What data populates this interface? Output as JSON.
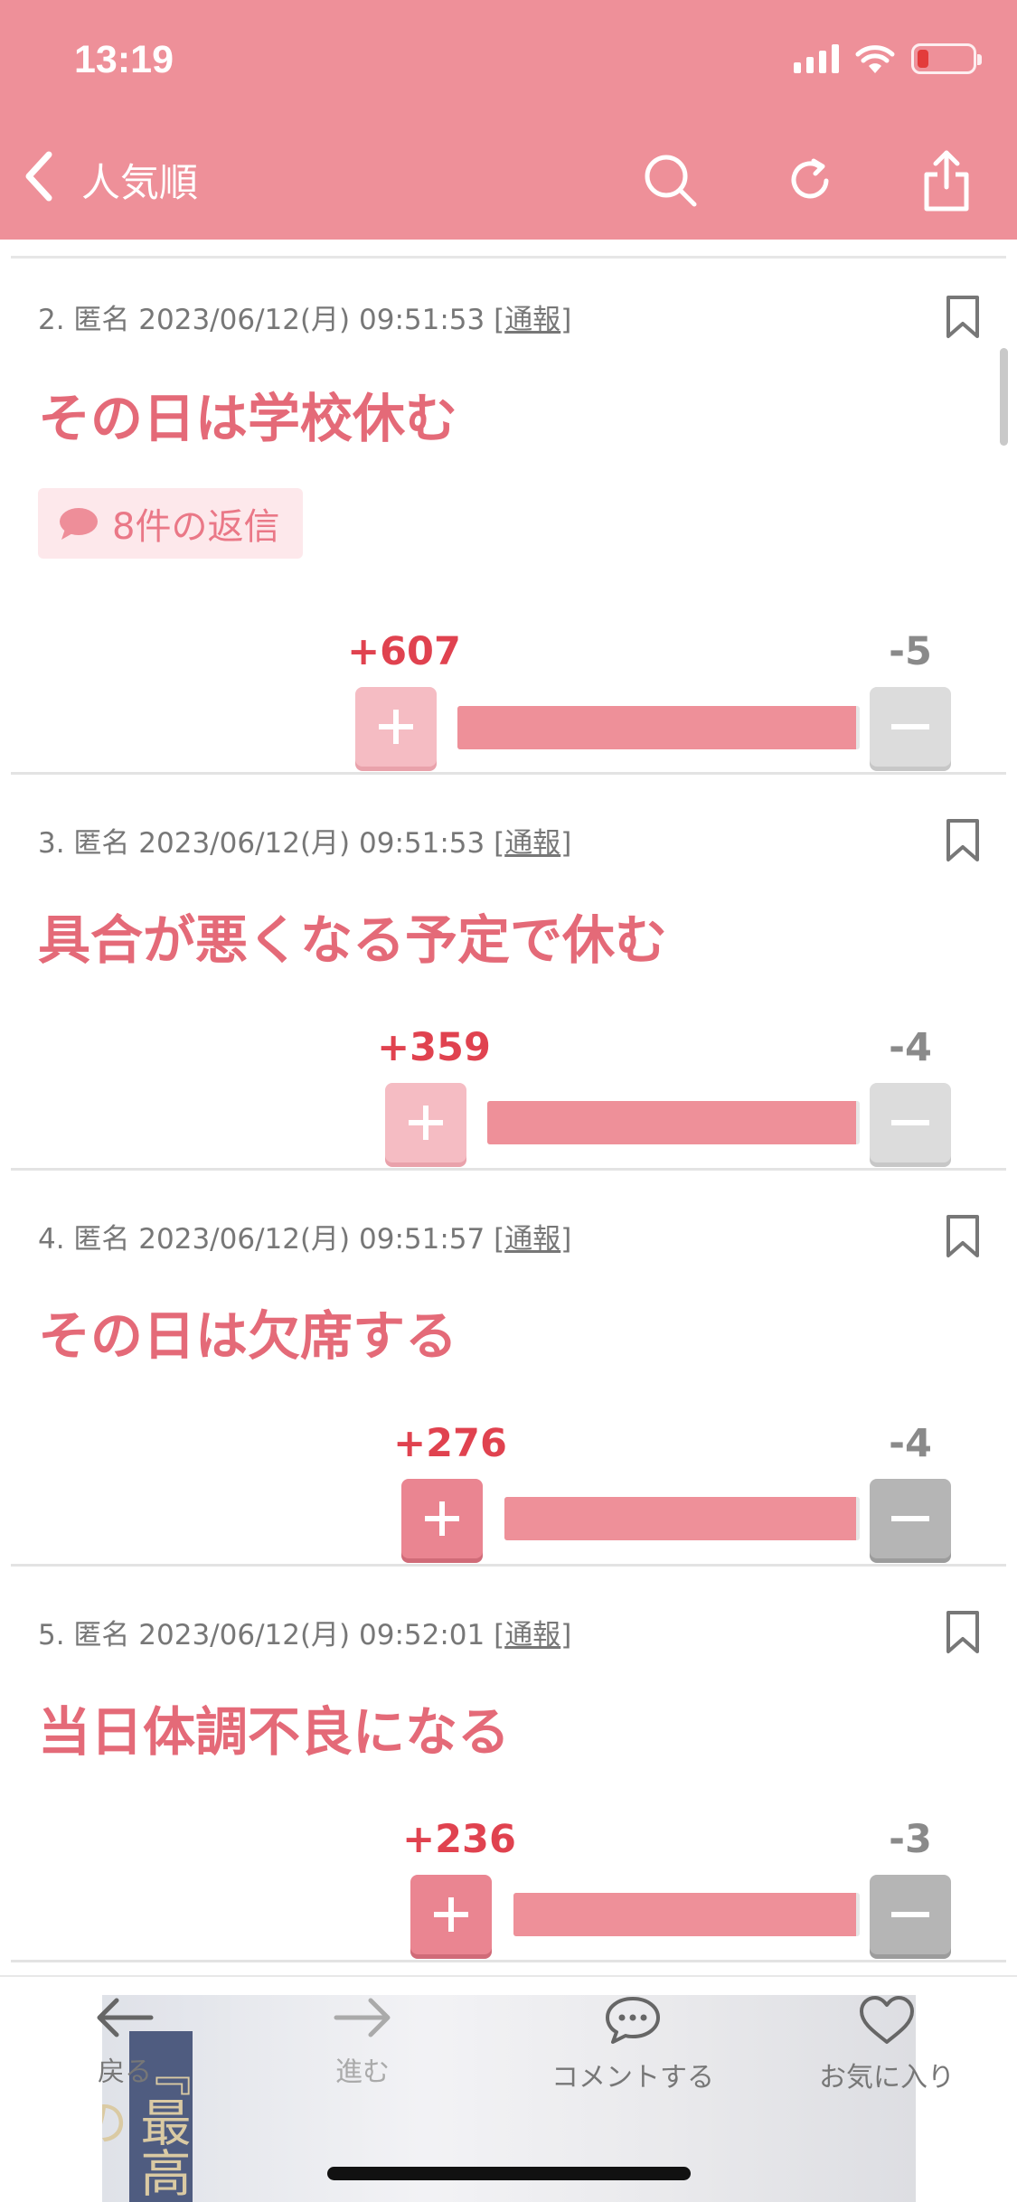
{
  "status_bar": {
    "time": "13:19"
  },
  "nav": {
    "title": "人気順"
  },
  "comments": [
    {
      "meta": "2. 匿名 2023/06/12(月) 09:51:53 [",
      "report": "通報",
      "meta_end": "]",
      "body": "その日は学校休む",
      "replies": "8件の返信",
      "plus": "+607",
      "minus": "-5",
      "ratio": 0.99
    },
    {
      "meta": "3. 匿名 2023/06/12(月) 09:51:53 [",
      "report": "通報",
      "meta_end": "]",
      "body": "具合が悪くなる予定で休む",
      "plus": "+359",
      "minus": "-4",
      "ratio": 0.99
    },
    {
      "meta": "4. 匿名 2023/06/12(月) 09:51:57 [",
      "report": "通報",
      "meta_end": "]",
      "body": "その日は欠席する",
      "plus": "+276",
      "minus": "-4",
      "ratio": 0.99
    },
    {
      "meta": "5. 匿名 2023/06/12(月) 09:52:01 [",
      "report": "通報",
      "meta_end": "]",
      "body": "当日体調不良になる",
      "plus": "+236",
      "minus": "-3",
      "ratio": 0.99
    }
  ],
  "tabbar": {
    "back": "戻る",
    "forward": "進む",
    "comment": "コメントする",
    "favorite": "お気に入り",
    "ad_text": "『最高の"
  },
  "colors": {
    "header": "#ee9099",
    "accent": "#e46a78",
    "plus_count": "#e0424f"
  }
}
